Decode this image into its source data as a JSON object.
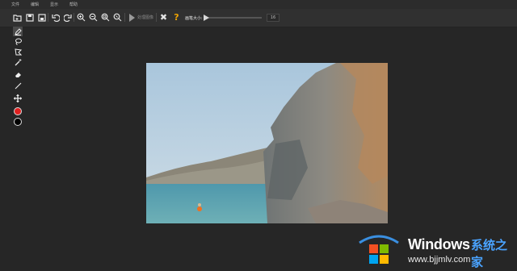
{
  "menu": {
    "items": [
      "文件",
      "编辑",
      "显示",
      "帮助"
    ]
  },
  "toolbar": {
    "play_label": "处理图像",
    "brush_size_label": "画笔大小:",
    "brush_size_value": "16",
    "icons": [
      "open-icon",
      "save-icon",
      "save-as-icon",
      "undo-icon",
      "redo-icon",
      "zoom-in-icon",
      "zoom-out-icon",
      "zoom-fit-icon",
      "zoom-reset-icon",
      "play-icon",
      "clear-icon",
      "help-icon"
    ]
  },
  "tools": [
    {
      "name": "marker",
      "active": true
    },
    {
      "name": "lasso",
      "active": false
    },
    {
      "name": "polygon-lasso",
      "active": false
    },
    {
      "name": "magic-wand",
      "active": false
    },
    {
      "name": "eraser",
      "active": false
    },
    {
      "name": "line",
      "active": false
    },
    {
      "name": "move",
      "active": false
    },
    {
      "name": "foreground-color",
      "color": "#e02020"
    },
    {
      "name": "background-color",
      "color": "#000000"
    }
  ],
  "watermark": {
    "brand": "Windows",
    "cn": "系统之家",
    "url": "www.bjjmlv.com"
  },
  "colors": {
    "bg": "#272727",
    "toolbar": "#303030",
    "accent_red": "#e02020",
    "watermark_blue": "#4aa3ff"
  }
}
